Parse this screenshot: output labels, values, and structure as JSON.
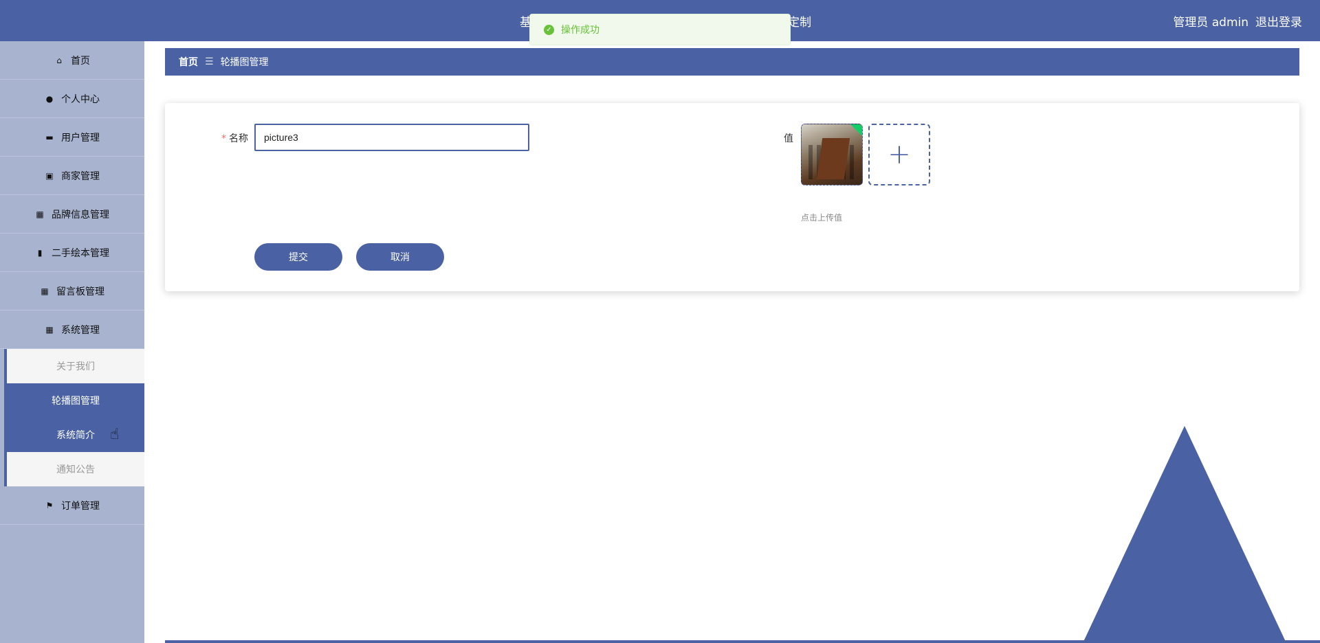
{
  "header": {
    "title_left": "基",
    "title_right": "定制",
    "user_role": "管理员 admin",
    "logout": "退出登录"
  },
  "toast": {
    "message": "操作成功",
    "icon": "check-circle-icon"
  },
  "sidebar": {
    "items": [
      {
        "label": "首页",
        "icon": "home-icon"
      },
      {
        "label": "个人中心",
        "icon": "user-icon"
      },
      {
        "label": "用户管理",
        "icon": "briefcase-icon"
      },
      {
        "label": "商家管理",
        "icon": "clipboard-icon"
      },
      {
        "label": "品牌信息管理",
        "icon": "grid-icon"
      },
      {
        "label": "二手绘本管理",
        "icon": "bar-chart-icon"
      },
      {
        "label": "留言板管理",
        "icon": "grid-icon"
      },
      {
        "label": "系统管理",
        "icon": "grid-icon"
      }
    ],
    "sub_items": [
      {
        "label": "关于我们",
        "active": false
      },
      {
        "label": "轮播图管理",
        "active": true
      },
      {
        "label": "系统简介",
        "active": true
      },
      {
        "label": "通知公告",
        "active": false
      }
    ],
    "last_item": {
      "label": "订单管理",
      "icon": "flag-icon"
    }
  },
  "breadcrumb": {
    "home": "首页",
    "separator": "☰",
    "current": "轮播图管理"
  },
  "form": {
    "name_label": "名称",
    "name_value": "picture3",
    "value_label": "值",
    "upload_hint": "点击上传值",
    "submit_label": "提交",
    "cancel_label": "取消"
  },
  "colors": {
    "primary": "#4a62a3",
    "sidebar_bg": "#a8b3cf",
    "success": "#67c23a"
  }
}
